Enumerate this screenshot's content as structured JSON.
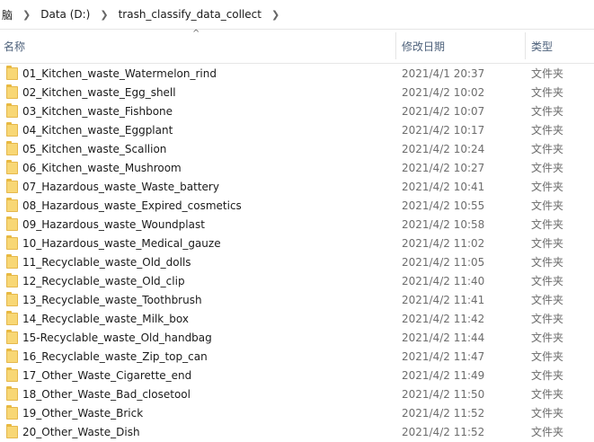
{
  "breadcrumb": [
    "脑",
    "Data (D:)",
    "trash_classify_data_collect"
  ],
  "sort_indicator": "^",
  "columns": {
    "name": "名称",
    "modified": "修改日期",
    "type": "类型"
  },
  "rows": [
    {
      "name": "01_Kitchen_waste_Watermelon_rind",
      "date": "2021/4/1 20:37",
      "type": "文件夹"
    },
    {
      "name": "02_Kitchen_waste_Egg_shell",
      "date": "2021/4/2 10:02",
      "type": "文件夹"
    },
    {
      "name": "03_Kitchen_waste_Fishbone",
      "date": "2021/4/2 10:07",
      "type": "文件夹"
    },
    {
      "name": "04_Kitchen_waste_Eggplant",
      "date": "2021/4/2 10:17",
      "type": "文件夹"
    },
    {
      "name": "05_Kitchen_waste_Scallion",
      "date": "2021/4/2 10:24",
      "type": "文件夹"
    },
    {
      "name": "06_Kitchen_waste_Mushroom",
      "date": "2021/4/2 10:27",
      "type": "文件夹"
    },
    {
      "name": "07_Hazardous_waste_Waste_battery",
      "date": "2021/4/2 10:41",
      "type": "文件夹"
    },
    {
      "name": "08_Hazardous_waste_Expired_cosmetics",
      "date": "2021/4/2 10:55",
      "type": "文件夹"
    },
    {
      "name": "09_Hazardous_waste_Woundplast",
      "date": "2021/4/2 10:58",
      "type": "文件夹"
    },
    {
      "name": "10_Hazardous_waste_Medical_gauze",
      "date": "2021/4/2 11:02",
      "type": "文件夹"
    },
    {
      "name": "11_Recyclable_waste_Old_dolls",
      "date": "2021/4/2 11:05",
      "type": "文件夹"
    },
    {
      "name": "12_Recyclable_waste_Old_clip",
      "date": "2021/4/2 11:40",
      "type": "文件夹"
    },
    {
      "name": "13_Recyclable_waste_Toothbrush",
      "date": "2021/4/2 11:41",
      "type": "文件夹"
    },
    {
      "name": "14_Recyclable_waste_Milk_box",
      "date": "2021/4/2 11:42",
      "type": "文件夹"
    },
    {
      "name": "15-Recyclable_waste_Old_handbag",
      "date": "2021/4/2 11:44",
      "type": "文件夹"
    },
    {
      "name": "16_Recyclable_waste_Zip_top_can",
      "date": "2021/4/2 11:47",
      "type": "文件夹"
    },
    {
      "name": "17_Other_Waste_Cigarette_end",
      "date": "2021/4/2 11:49",
      "type": "文件夹"
    },
    {
      "name": "18_Other_Waste_Bad_closetool",
      "date": "2021/4/2 11:50",
      "type": "文件夹"
    },
    {
      "name": "19_Other_Waste_Brick",
      "date": "2021/4/2 11:52",
      "type": "文件夹"
    },
    {
      "name": "20_Other_Waste_Dish",
      "date": "2021/4/2 11:52",
      "type": "文件夹"
    }
  ],
  "icons": {
    "folder": "folder-icon",
    "separator": "chevron-right-icon",
    "sort": "sort-up-icon"
  },
  "colors": {
    "folder": "#f8d775",
    "header_text": "#4c607a",
    "secondary_text": "#6d6d6d"
  }
}
